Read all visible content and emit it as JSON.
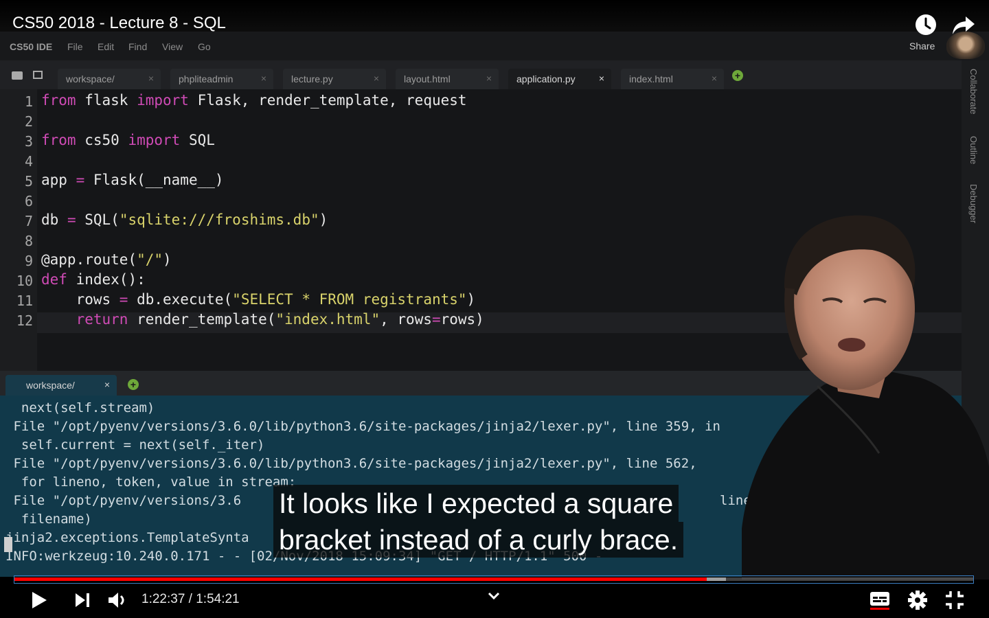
{
  "video": {
    "title": "CS50 2018 - Lecture 8 - SQL",
    "share_label": "Share",
    "icons": [
      "clock-icon",
      "share-arrow-icon"
    ]
  },
  "ide": {
    "brand": "CS50 IDE",
    "menu": [
      "File",
      "Edit",
      "Find",
      "View",
      "Go"
    ],
    "tabs": [
      {
        "label": "workspace/",
        "active": false
      },
      {
        "label": "phpliteadmin",
        "active": false
      },
      {
        "label": "lecture.py",
        "active": false
      },
      {
        "label": "layout.html",
        "active": false
      },
      {
        "label": "application.py",
        "active": true
      },
      {
        "label": "index.html",
        "active": false
      }
    ],
    "tab_close": "×",
    "plus": "+",
    "side_tabs": [
      "Collaborate",
      "Outline",
      "Debugger"
    ],
    "line_numbers": [
      "1",
      "2",
      "3",
      "4",
      "5",
      "6",
      "7",
      "8",
      "9",
      "10",
      "11",
      "12"
    ],
    "code": {
      "l1": {
        "kw1": "from",
        "t1": " flask ",
        "kw2": "import",
        "t2": " Flask, render_template, request"
      },
      "l3": {
        "kw1": "from",
        "t1": " cs50 ",
        "kw2": "import",
        "t2": " SQL"
      },
      "l5": {
        "t1": "app ",
        "op": "=",
        "t2": " Flask(__name__)"
      },
      "l7": {
        "t1": "db ",
        "op": "=",
        "t2": " SQL(",
        "str": "\"sqlite:///froshims.db\"",
        "t3": ")"
      },
      "l9": {
        "t1": "@app.route(",
        "str": "\"/\"",
        "t2": ")"
      },
      "l10": {
        "kw": "def",
        "t1": " index():"
      },
      "l11": {
        "t1": "    rows ",
        "op": "=",
        "t2": " db.execute(",
        "str": "\"SELECT * FROM registrants\"",
        "t3": ")"
      },
      "l12": {
        "indent": "    ",
        "kw": "return",
        "t1": " render_template(",
        "str": "\"index.html\"",
        "t2": ", rows",
        "op": "=",
        "t3": "rows)"
      }
    },
    "terminal_tab": "workspace/",
    "terminal_lines": [
      "  next(self.stream)",
      " File \"/opt/pyenv/versions/3.6.0/lib/python3.6/site-packages/jinja2/lexer.py\", line 359, in",
      "  self.current = next(self._iter)",
      " File \"/opt/pyenv/versions/3.6.0/lib/python3.6/site-packages/jinja2/lexer.py\", line 562,",
      "  for lineno, token, value in stream:",
      " File \"/opt/pyenv/versions/3.6",
      "  filename)",
      "jinja2.exceptions.TemplateSynta",
      "INFO:werkzeug:10.240.0.171 - - [02/Nov/2018 15:09:34] \"GET / HTTP/1.1\" 500 -"
    ],
    "terminal_line_tail": "line 690"
  },
  "captions": [
    "It looks like I expected a square",
    "bracket instead of a curly brace."
  ],
  "player": {
    "time": "1:22:37 / 1:54:21",
    "progress_played": 0.722,
    "progress_buffered": 0.742,
    "accent": "#ff0000",
    "icons": [
      "play-icon",
      "next-icon",
      "volume-icon",
      "chevron-down-icon",
      "subtitles-icon",
      "settings-icon",
      "exit-fullscreen-icon"
    ]
  }
}
